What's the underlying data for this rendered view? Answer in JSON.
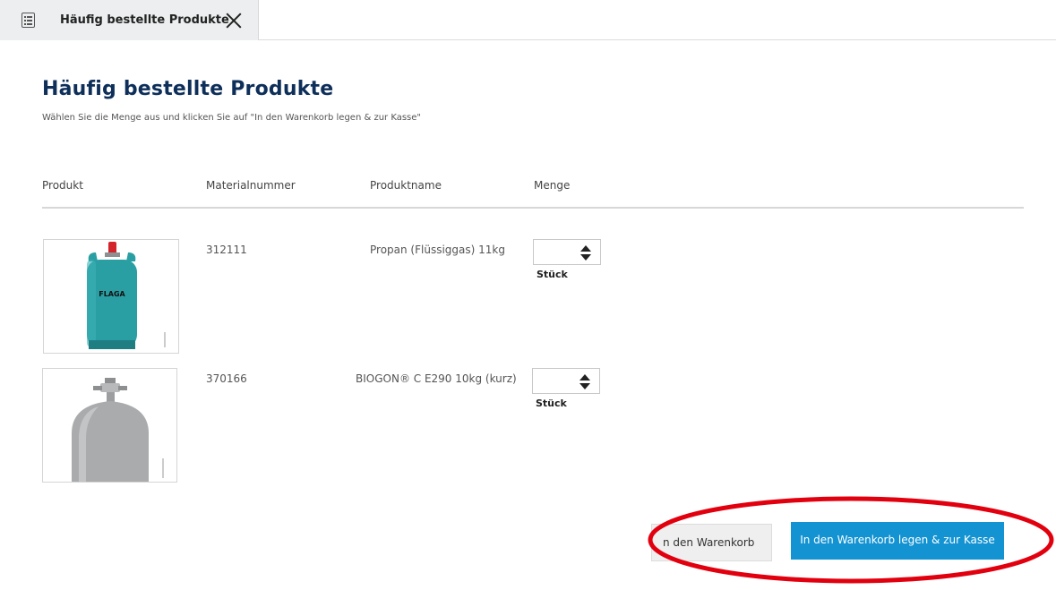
{
  "tab": {
    "icon": "document-list-icon",
    "label": "Häufig bestellte Produkte",
    "close_icon": "close-icon"
  },
  "header": {
    "title": "Häufig bestellte Produkte",
    "subtitle": "Wählen Sie die Menge aus und klicken Sie auf \"In den Warenkorb legen & zur Kasse\""
  },
  "table": {
    "columns": [
      "Produkt",
      "Materialnummer",
      "Produktname",
      "Menge"
    ],
    "rows": [
      {
        "image": "propane-gas-cylinder-image",
        "material_number": "312111",
        "product_name": "Propan (Flüssiggas) 11kg",
        "quantity": "",
        "unit": "Stück",
        "image_brand_text": "FLAGA"
      },
      {
        "image": "biogon-gas-cylinder-image",
        "material_number": "370166",
        "product_name": "BIOGON® C E290 10kg (kurz)",
        "quantity": "",
        "unit": "Stück"
      }
    ]
  },
  "actions": {
    "add_to_cart_partial": "n den Warenkorb",
    "checkout": "In den Warenkorb legen & zur Kasse"
  },
  "colors": {
    "title": "#0e2f5a",
    "checkout_button": "#1493d2",
    "highlight_annotation": "#e2000f",
    "cylinder_teal": "#2a9fa3",
    "cylinder_valve_red": "#d3242c",
    "cylinder_grey": "#a9abad"
  }
}
